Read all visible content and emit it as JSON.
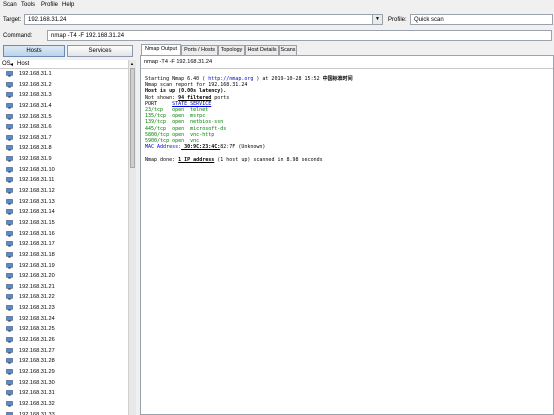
{
  "menu": {
    "items": [
      "Scan",
      "Tools",
      "Profile",
      "Help"
    ]
  },
  "target": {
    "label": "Target:",
    "value": "192.168.31.24"
  },
  "profile": {
    "label": "Profile:",
    "value": "Quick scan"
  },
  "command": {
    "label": "Command:",
    "value": "nmap -T4 -F 192.168.31.24"
  },
  "left": {
    "hosts_button": "Hosts",
    "services_button": "Services",
    "col_os": "OS",
    "col_host": "Host",
    "hosts": [
      "192.168.31.1",
      "192.168.31.2",
      "192.168.31.3",
      "192.168.31.4",
      "192.168.31.5",
      "192.168.31.6",
      "192.168.31.7",
      "192.168.31.8",
      "192.168.31.9",
      "192.168.31.10",
      "192.168.31.11",
      "192.168.31.12",
      "192.168.31.13",
      "192.168.31.14",
      "192.168.31.15",
      "192.168.31.16",
      "192.168.31.17",
      "192.168.31.18",
      "192.168.31.19",
      "192.168.31.20",
      "192.168.31.21",
      "192.168.31.22",
      "192.168.31.23",
      "192.168.31.24",
      "192.168.31.25",
      "192.168.31.26",
      "192.168.31.27",
      "192.168.31.28",
      "192.168.31.29",
      "192.168.31.30",
      "192.168.31.31",
      "192.168.31.32",
      "192.168.31.33"
    ]
  },
  "tabs": [
    "Nmap Output",
    "Ports / Hosts",
    "Topology",
    "Host Details",
    "Scans"
  ],
  "output": {
    "command_line": "nmap -T4 -F 192.168.31.24",
    "start_pre": "Starting Nmap 6.40 ( ",
    "start_link": "http://nmap.org",
    "start_post": " ) at 2019-10-28 15:52 ",
    "start_tz": "中国标准时间",
    "report": "Nmap scan report for 192.168.31.24",
    "host_up": "Host is up (0.00s latency).",
    "not_shown_pre": "Not shown: ",
    "not_shown_bold": "94 filtered",
    "not_shown_post": " ports",
    "header_port": "PORT     ",
    "header_rest": "STATE SERVICE",
    "ports": [
      "23/tcp   open  telnet",
      "135/tcp  open  msrpc",
      "139/tcp  open  netbios-ssn",
      "445/tcp  open  microsoft-ds",
      "5800/tcp open  vnc-http",
      "5900/tcp open  vnc"
    ],
    "mac_label": "MAC Address:",
    "mac_value": " 30:9C:23:4C:",
    "mac_rest": "82:7F (Unknown)",
    "done_pre": "Nmap done: ",
    "done_link": "1 IP address",
    "done_post": " (1 host up) scanned in 8.98 seconds"
  },
  "colors": {
    "accent": "#6a8bb3",
    "open_port": "#008000",
    "link": "#0000cc"
  }
}
